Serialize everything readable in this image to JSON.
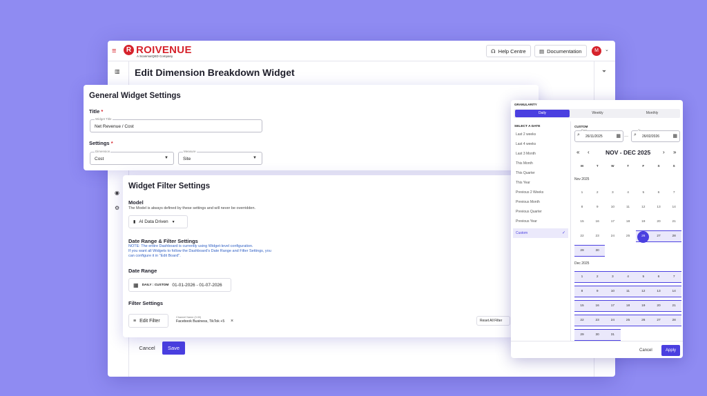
{
  "app": {
    "logo_text": "ROIVENUE",
    "logo_sub": "A ScanmarQED Company",
    "help_label": "Help Centre",
    "docs_label": "Documentation",
    "avatar_initial": "M",
    "page_title": "Edit Dimension Breakdown Widget",
    "cancel_label": "Cancel",
    "save_label": "Save"
  },
  "general": {
    "heading": "General Widget Settings",
    "title_label": "Title",
    "required_mark": "*",
    "widget_title_legend": "Widget Title",
    "widget_title_value": "Net Revenue / Cost",
    "settings_label": "Settings",
    "dimension_legend": "Dimension",
    "dimension_value": "Cost",
    "measure_legend": "Measure",
    "measure_value": "Site"
  },
  "filter": {
    "heading": "Widget Filter Settings",
    "model_label": "Model",
    "model_note": "The Model is always defined by these settings and will never be overridden.",
    "model_value": "AI Data Driven",
    "date_range_section": "Date Range & Filter Settings",
    "note_line1": "NOTE: The entire Dashboard is currently using Widget-level configuration.",
    "note_line2": "If you want all Widgets to follow the Dashboard's Date Range and Filter Settings, you",
    "note_line3": "can configure it in \"Edit Board\".",
    "date_range_label": "Date Range",
    "date_mode": "DAILY : CUSTOM",
    "date_value": "01-01-2026 - 01-07-2026",
    "filter_settings_label": "Filter Settings",
    "edit_filter_label": "Edit Filter",
    "chip_legend": "Channel Name (3.00)",
    "chip_value": "Facebook Business, TikTok +5",
    "chip_close": "×",
    "reset_label": "Reset All Filter"
  },
  "picker": {
    "granularity_label": "GRANULARITY",
    "granularity": [
      "Daily",
      "Weekly",
      "Monthly"
    ],
    "granularity_selected": "Daily",
    "select_date_label": "SELECT A DATE",
    "presets": [
      "Last 2 weeks",
      "Last 4 weeks",
      "Last 3 Month",
      "This Month",
      "This Quarter",
      "This Year",
      "Previous 2 Weeks",
      "Previous Month",
      "Previous Quarter",
      "Previous Year",
      "Custom"
    ],
    "preset_selected": "Custom",
    "custom_label": "CUSTOM",
    "from_legend": "From",
    "from_value": "26/11/2025",
    "to_legend": "To",
    "to_value": "26/02/2026",
    "month_range_title": "NOV - DEC 2025",
    "weekdays": [
      "M",
      "T",
      "W",
      "T",
      "F",
      "S",
      "S"
    ],
    "months": [
      {
        "label": "Nov 2025",
        "first_weekday": 0,
        "days": 30,
        "range_start": 26
      },
      {
        "label": "Dec 2025",
        "first_weekday": 0,
        "days": 31,
        "range_start": 1
      }
    ],
    "cancel_label": "Cancel",
    "apply_label": "Apply"
  }
}
